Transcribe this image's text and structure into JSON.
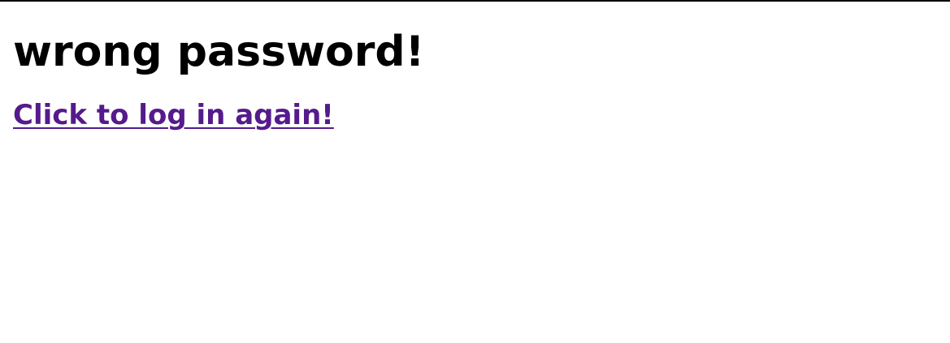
{
  "page": {
    "title": "wrong password!",
    "link_label": "Click to log in again!"
  },
  "colors": {
    "text": "#000000",
    "link_visited": "#551a8b",
    "background": "#ffffff"
  }
}
